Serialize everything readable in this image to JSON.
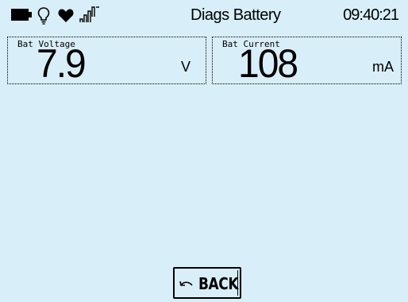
{
  "status_bar": {
    "icons": [
      "battery-icon",
      "bulb-icon",
      "heart-icon",
      "signal-icon"
    ],
    "title": "Diags Battery",
    "time": "09:40:21"
  },
  "tiles": [
    {
      "label": "Bat Voltage",
      "value": "7.9",
      "unit": "V"
    },
    {
      "label": "Bat Current",
      "value": "108",
      "unit": "mA"
    }
  ],
  "back_button": {
    "label": "BACK",
    "icon": "back-arrow-icon"
  },
  "colors": {
    "background": "#d8eef8",
    "foreground": "#000000"
  }
}
